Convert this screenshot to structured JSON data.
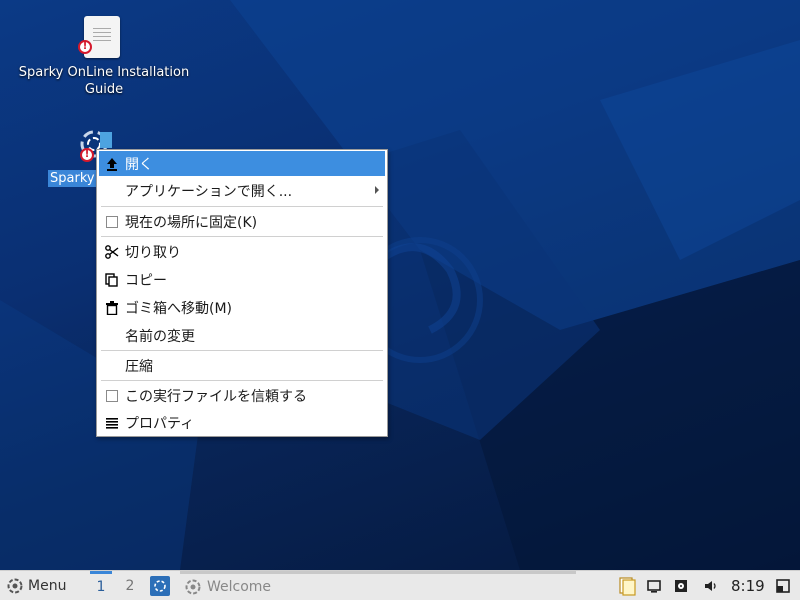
{
  "desktop": {
    "icons": [
      {
        "label": "Sparky OnLine Installation Guide"
      },
      {
        "label": "Sparky"
      }
    ]
  },
  "context_menu": {
    "items": [
      {
        "label": "開く",
        "icon": "upload-icon",
        "active": true
      },
      {
        "label": "アプリケーションで開く...",
        "submenu": true
      },
      {
        "label": "現在の場所に固定(K)",
        "icon": "checkbox-icon"
      },
      {
        "label": "切り取り",
        "icon": "scissors-icon"
      },
      {
        "label": "コピー",
        "icon": "copy-icon"
      },
      {
        "label": "ゴミ箱へ移動(M)",
        "icon": "trash-icon"
      },
      {
        "label": "名前の変更"
      },
      {
        "label": "圧縮"
      },
      {
        "label": "この実行ファイルを信頼する",
        "icon": "checkbox-icon"
      },
      {
        "label": "プロパティ",
        "icon": "properties-icon"
      }
    ]
  },
  "taskbar": {
    "menu_label": "Menu",
    "workspaces": [
      "1",
      "2"
    ],
    "active_workspace": "1",
    "window_title": "Welcome",
    "clock": "8:19"
  },
  "colors": {
    "menu_highlight": "#3d8ee0",
    "selection": "#3a86d8",
    "taskbar_bg": "#e9e9e9",
    "desktop_dark": "#05183c",
    "desktop_blue": "#0b3a86"
  }
}
